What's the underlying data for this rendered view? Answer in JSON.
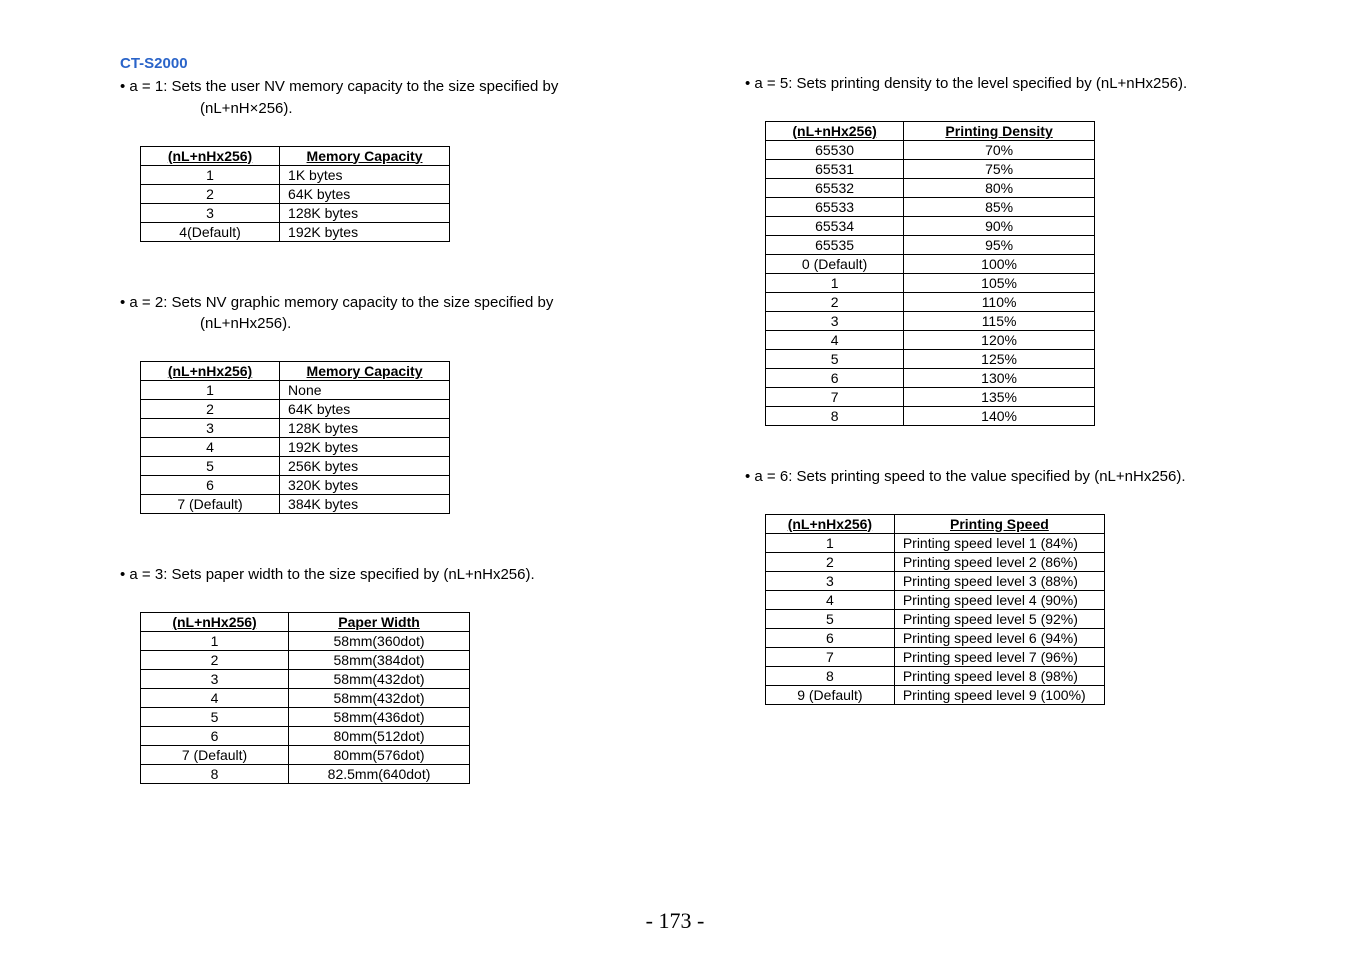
{
  "model": "CT-S2000",
  "bullets": {
    "a1_line1": "• a = 1: Sets the user NV memory capacity to the size specified by",
    "a1_line2": "(nL+nH×256).",
    "a2_line1": "• a = 2: Sets NV graphic memory capacity to the size specified by",
    "a2_line2": "(nL+nHx256).",
    "a3": "• a = 3: Sets paper width to the size specified by (nL+nHx256).",
    "a5": "• a = 5: Sets printing density to the level specified by (nL+nHx256).",
    "a6": "• a = 6: Sets printing speed to the value specified by (nL+nHx256)."
  },
  "headers": {
    "param": "(nL+nHx256)",
    "memcap": "Memory Capacity",
    "paperw": "Paper Width",
    "density": "Printing Density",
    "speed": "Printing Speed"
  },
  "t_a1": [
    {
      "k": "1",
      "v": "1K bytes"
    },
    {
      "k": "2",
      "v": "64K bytes"
    },
    {
      "k": "3",
      "v": "128K bytes"
    },
    {
      "k": "4(Default)",
      "v": "192K bytes"
    }
  ],
  "t_a2": [
    {
      "k": "1",
      "v": "None"
    },
    {
      "k": "2",
      "v": "64K bytes"
    },
    {
      "k": "3",
      "v": "128K bytes"
    },
    {
      "k": "4",
      "v": "192K bytes"
    },
    {
      "k": "5",
      "v": "256K bytes"
    },
    {
      "k": "6",
      "v": "320K bytes"
    },
    {
      "k": "7 (Default)",
      "v": "384K bytes"
    }
  ],
  "t_a3": [
    {
      "k": "1",
      "v": "58mm(360dot)"
    },
    {
      "k": "2",
      "v": "58mm(384dot)"
    },
    {
      "k": "3",
      "v": "58mm(432dot)"
    },
    {
      "k": "4",
      "v": "58mm(432dot)"
    },
    {
      "k": "5",
      "v": "58mm(436dot)"
    },
    {
      "k": "6",
      "v": "80mm(512dot)"
    },
    {
      "k": "7 (Default)",
      "v": "80mm(576dot)"
    },
    {
      "k": "8",
      "v": "82.5mm(640dot)"
    }
  ],
  "t_a5": [
    {
      "k": "65530",
      "v": "70%"
    },
    {
      "k": "65531",
      "v": "75%"
    },
    {
      "k": "65532",
      "v": "80%"
    },
    {
      "k": "65533",
      "v": "85%"
    },
    {
      "k": "65534",
      "v": "90%"
    },
    {
      "k": "65535",
      "v": "95%"
    },
    {
      "k": "0 (Default)",
      "v": "100%"
    },
    {
      "k": "1",
      "v": "105%"
    },
    {
      "k": "2",
      "v": "110%"
    },
    {
      "k": "3",
      "v": "115%"
    },
    {
      "k": "4",
      "v": "120%"
    },
    {
      "k": "5",
      "v": "125%"
    },
    {
      "k": "6",
      "v": "130%"
    },
    {
      "k": "7",
      "v": "135%"
    },
    {
      "k": "8",
      "v": "140%"
    }
  ],
  "t_a6": [
    {
      "k": "1",
      "v": "Printing speed level 1 (84%)"
    },
    {
      "k": "2",
      "v": "Printing speed level 2 (86%)"
    },
    {
      "k": "3",
      "v": "Printing speed level 3 (88%)"
    },
    {
      "k": "4",
      "v": "Printing speed level 4 (90%)"
    },
    {
      "k": "5",
      "v": "Printing speed level 5 (92%)"
    },
    {
      "k": "6",
      "v": "Printing speed level 6 (94%)"
    },
    {
      "k": "7",
      "v": "Printing speed level 7 (96%)"
    },
    {
      "k": "8",
      "v": "Printing speed level 8 (98%)"
    },
    {
      "k": "9 (Default)",
      "v": "Printing speed level 9 (100%)"
    }
  ],
  "chart_data": [
    {
      "type": "table",
      "title": "a=1 User NV memory capacity",
      "columns": [
        "(nL+nHx256)",
        "Memory Capacity"
      ],
      "rows": [
        [
          "1",
          "1K bytes"
        ],
        [
          "2",
          "64K bytes"
        ],
        [
          "3",
          "128K bytes"
        ],
        [
          "4(Default)",
          "192K bytes"
        ]
      ]
    },
    {
      "type": "table",
      "title": "a=2 NV graphic memory capacity",
      "columns": [
        "(nL+nHx256)",
        "Memory Capacity"
      ],
      "rows": [
        [
          "1",
          "None"
        ],
        [
          "2",
          "64K bytes"
        ],
        [
          "3",
          "128K bytes"
        ],
        [
          "4",
          "192K bytes"
        ],
        [
          "5",
          "256K bytes"
        ],
        [
          "6",
          "320K bytes"
        ],
        [
          "7 (Default)",
          "384K bytes"
        ]
      ]
    },
    {
      "type": "table",
      "title": "a=3 Paper width",
      "columns": [
        "(nL+nHx256)",
        "Paper Width"
      ],
      "rows": [
        [
          "1",
          "58mm(360dot)"
        ],
        [
          "2",
          "58mm(384dot)"
        ],
        [
          "3",
          "58mm(432dot)"
        ],
        [
          "4",
          "58mm(432dot)"
        ],
        [
          "5",
          "58mm(436dot)"
        ],
        [
          "6",
          "80mm(512dot)"
        ],
        [
          "7 (Default)",
          "80mm(576dot)"
        ],
        [
          "8",
          "82.5mm(640dot)"
        ]
      ]
    },
    {
      "type": "table",
      "title": "a=5 Printing density",
      "columns": [
        "(nL+nHx256)",
        "Printing Density"
      ],
      "rows": [
        [
          "65530",
          "70%"
        ],
        [
          "65531",
          "75%"
        ],
        [
          "65532",
          "80%"
        ],
        [
          "65533",
          "85%"
        ],
        [
          "65534",
          "90%"
        ],
        [
          "65535",
          "95%"
        ],
        [
          "0 (Default)",
          "100%"
        ],
        [
          "1",
          "105%"
        ],
        [
          "2",
          "110%"
        ],
        [
          "3",
          "115%"
        ],
        [
          "4",
          "120%"
        ],
        [
          "5",
          "125%"
        ],
        [
          "6",
          "130%"
        ],
        [
          "7",
          "135%"
        ],
        [
          "8",
          "140%"
        ]
      ]
    },
    {
      "type": "table",
      "title": "a=6 Printing speed",
      "columns": [
        "(nL+nHx256)",
        "Printing Speed"
      ],
      "rows": [
        [
          "1",
          "Printing speed level 1 (84%)"
        ],
        [
          "2",
          "Printing speed level 2 (86%)"
        ],
        [
          "3",
          "Printing speed level 3 (88%)"
        ],
        [
          "4",
          "Printing speed level 4 (90%)"
        ],
        [
          "5",
          "Printing speed level 5 (92%)"
        ],
        [
          "6",
          "Printing speed level 6 (94%)"
        ],
        [
          "7",
          "Printing speed level 7 (96%)"
        ],
        [
          "8",
          "Printing speed level 8 (98%)"
        ],
        [
          "9 (Default)",
          "Printing speed level 9 (100%)"
        ]
      ]
    }
  ],
  "page_number": "- 173 -"
}
